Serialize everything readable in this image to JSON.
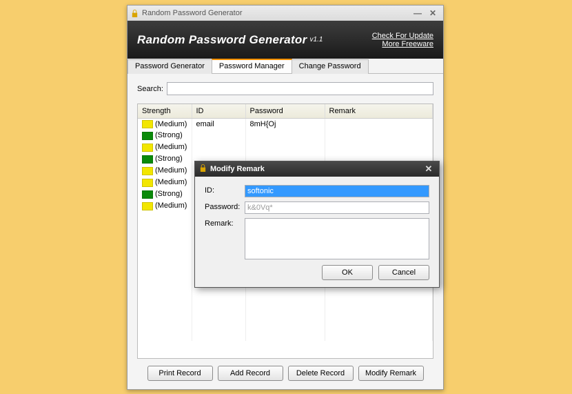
{
  "window": {
    "title": "Random Password Generator"
  },
  "banner": {
    "title": "Random Password Generator",
    "version": "v1.1",
    "link_update": "Check For Update",
    "link_freeware": "More Freeware"
  },
  "tabs": {
    "t1": "Password Generator",
    "t2": "Password Manager",
    "t3": "Change Password"
  },
  "search": {
    "label": "Search:",
    "value": ""
  },
  "table": {
    "headers": {
      "strength": "Strength",
      "id": "ID",
      "password": "Password",
      "remark": "Remark"
    },
    "rows": [
      {
        "strength_label": "(Medium)",
        "color": "#f2e600",
        "id": "email",
        "password": "8mH{Oj",
        "remark": ""
      },
      {
        "strength_label": "(Strong)",
        "color": "#0a8a0a",
        "id": "",
        "password": "",
        "remark": ""
      },
      {
        "strength_label": "(Medium)",
        "color": "#f2e600",
        "id": "",
        "password": "",
        "remark": ""
      },
      {
        "strength_label": "(Strong)",
        "color": "#0a8a0a",
        "id": "",
        "password": "",
        "remark": ""
      },
      {
        "strength_label": "(Medium)",
        "color": "#f2e600",
        "id": "",
        "password": "",
        "remark": ""
      },
      {
        "strength_label": "(Medium)",
        "color": "#f2e600",
        "id": "",
        "password": "",
        "remark": ""
      },
      {
        "strength_label": "(Strong)",
        "color": "#0a8a0a",
        "id": "",
        "password": "",
        "remark": ""
      },
      {
        "strength_label": "(Medium)",
        "color": "#f2e600",
        "id": "",
        "password": "",
        "remark": ""
      }
    ]
  },
  "footer": {
    "print": "Print Record",
    "add": "Add Record",
    "delete": "Delete Record",
    "modify": "Modify Remark"
  },
  "dialog": {
    "title": "Modify Remark",
    "id_label": "ID:",
    "id_value": "softonic",
    "pw_label": "Password:",
    "pw_value": "k&0Vq*",
    "remark_label": "Remark:",
    "remark_value": "",
    "ok": "OK",
    "cancel": "Cancel"
  }
}
